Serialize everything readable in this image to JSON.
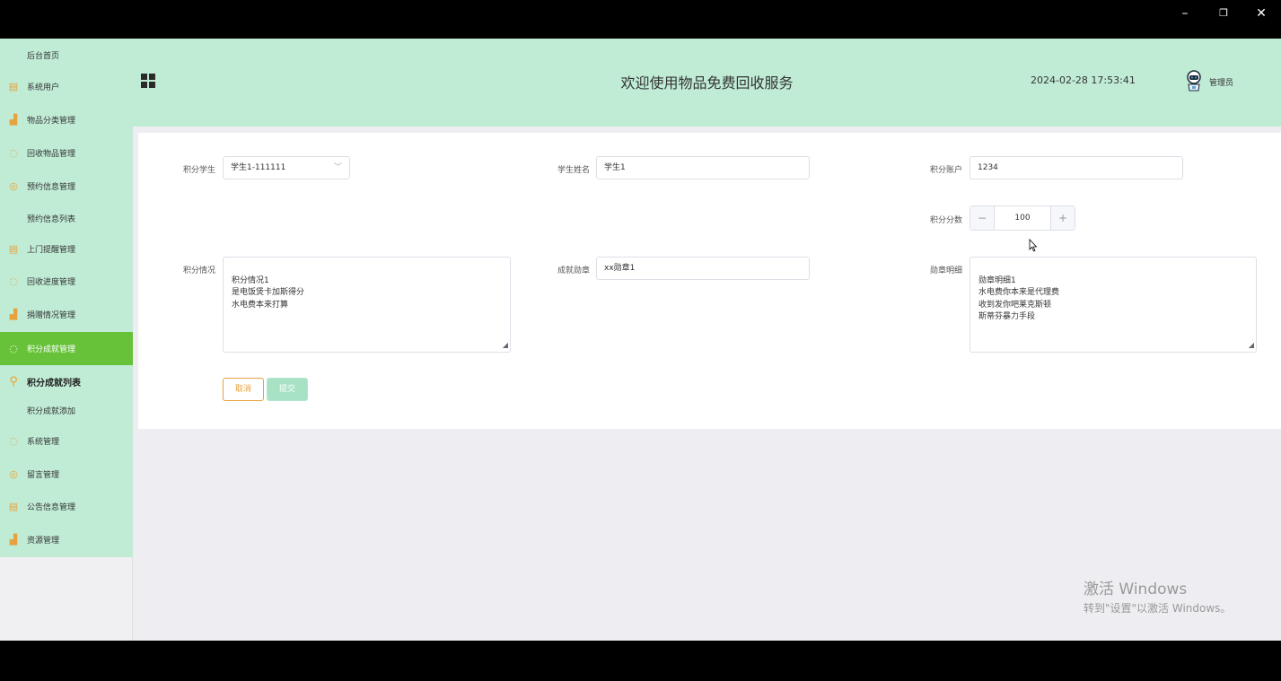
{
  "window": {
    "minimize": "–",
    "restore": "❐",
    "close": "✕"
  },
  "sidebar": {
    "items": [
      {
        "label": "后台首页",
        "icon": ""
      },
      {
        "label": "系统用户",
        "icon": "document-icon"
      },
      {
        "label": "物品分类管理",
        "icon": "bar-chart-icon"
      },
      {
        "label": "回收物品管理",
        "icon": "chat-icon"
      },
      {
        "label": "预约信息管理",
        "icon": "check-circle-icon"
      },
      {
        "label": "预约信息列表",
        "icon": ""
      },
      {
        "label": "上门提醒管理",
        "icon": "document-icon"
      },
      {
        "label": "回收进度管理",
        "icon": "chat-icon"
      },
      {
        "label": "捐赠情况管理",
        "icon": "bar-chart-icon"
      },
      {
        "label": "积分成就管理",
        "icon": "chat-icon"
      },
      {
        "label": "积分成就列表",
        "icon": "location-icon"
      },
      {
        "label": "积分成就添加",
        "icon": ""
      },
      {
        "label": "系统管理",
        "icon": "chat-icon"
      },
      {
        "label": "留言管理",
        "icon": "check-circle-icon"
      },
      {
        "label": "公告信息管理",
        "icon": "document-icon"
      },
      {
        "label": "资源管理",
        "icon": "bar-chart-icon"
      }
    ]
  },
  "header": {
    "title": "欢迎使用物品免费回收服务",
    "datetime": "2024-02-28 17:53:41",
    "user": "管理员"
  },
  "form": {
    "student_label": "积分学生",
    "student_value": "学生1-111111",
    "name_label": "学生姓名",
    "name_value": "学生1",
    "account_label": "积分账户",
    "account_value": "1234",
    "score_label": "积分分数",
    "score_value": "100",
    "situation_label": "积分情况",
    "situation_value": "积分情况1\n是电饭煲卡加斯得分\n水电费本来打算",
    "badge_label": "成就勋章",
    "badge_value": "xx勋章1",
    "detail_label": "勋章明细",
    "detail_value": "勋章明细1\n水电费你本来是代理费\n收到发你吧莱克斯顿\n斯蒂芬暴力手段",
    "cancel": "取消",
    "submit": "提交"
  },
  "watermark": {
    "line1": "激活 Windows",
    "line2": "转到\"设置\"以激活 Windows。"
  },
  "colors": {
    "menu_bg": "#c0ecd6",
    "active": "#67c23a",
    "accent": "#e6a23c"
  }
}
